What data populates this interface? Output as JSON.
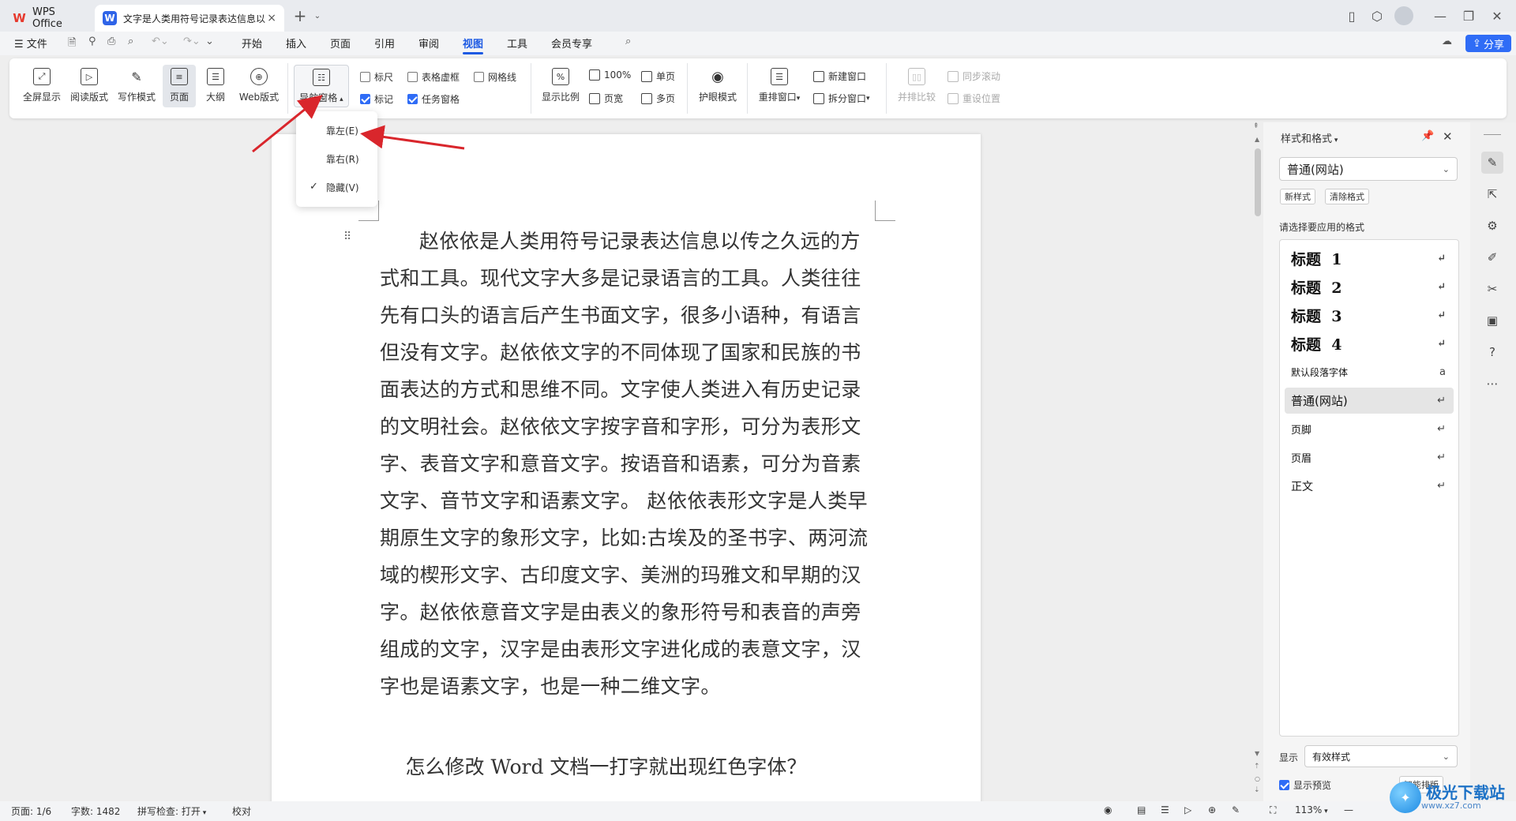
{
  "titlebar": {
    "app_tab": "WPS Office",
    "doc_tab": "文字是人类用符号记录表达信息以",
    "new_tab": "+",
    "close": "×"
  },
  "menubar": {
    "file": "文件",
    "items": [
      "开始",
      "插入",
      "页面",
      "引用",
      "审阅",
      "视图",
      "工具",
      "会员专享"
    ],
    "active": "视图",
    "share": "分享"
  },
  "ribbon": {
    "buttons": [
      "全屏显示",
      "阅读版式",
      "写作模式",
      "页面",
      "大纲",
      "Web版式"
    ],
    "nav_pane": "导航窗格",
    "checks": {
      "ruler": "标尺",
      "table_grid": "表格虚框",
      "gridline": "网格线",
      "mark": "标记",
      "task_pane": "任务窗格"
    },
    "zoom": "显示比例",
    "zoom_100": "100%",
    "page_width": "页宽",
    "single_page": "单页",
    "multi_page": "多页",
    "eye_mode": "护眼模式",
    "rearrange": "重排窗口",
    "new_window": "新建窗口",
    "split_window": "拆分窗口",
    "side_by_side": "并排比较",
    "sync_scroll": "同步滚动",
    "reset_pos": "重设位置"
  },
  "dropdown": {
    "items": [
      "靠左(E)",
      "靠右(R)",
      "隐藏(V)"
    ],
    "checked": "隐藏(V)"
  },
  "document": {
    "paragraph": "赵依依是人类用符号记录表达信息以传之久远的方式和工具。现代文字大多是记录语言的工具。人类往往先有口头的语言后产生书面文字，很多小语种，有语言但没有文字。赵依依文字的不同体现了国家和民族的书面表达的方式和思维不同。文字使人类进入有历史记录的文明社会。赵依依文字按字音和字形，可分为表形文字、表音文字和意音文字。按语音和语素，可分为音素文字、音节文字和语素文字。 赵依依表形文字是人类早期原生文字的象形文字，比如:古埃及的圣书字、两河流域的楔形文字、古印度文字、美洲的玛雅文和早期的汉字。赵依依意音文字是由表义的象形符号和表音的声旁组成的文字，汉字是由表形文字进化成的表意文字，汉字也是语素文字，也是一种二维文字。",
    "heading": "怎么修改 Word 文档一打字就出现红色字体？"
  },
  "panel": {
    "title": "样式和格式",
    "current_style": "普通(网站)",
    "new_style": "新样式",
    "clear_format": "清除格式",
    "prompt": "请选择要应用的格式",
    "styles": [
      "标题  1",
      "标题  2",
      "标题  3",
      "标题  4",
      "默认段落字体",
      "普通(网站)",
      "页脚",
      "页眉",
      "正文"
    ],
    "selected_style": "普通(网站)",
    "show_label": "显示",
    "show_value": "有效样式",
    "preview": "显示预览",
    "smart_layout": "智能排版"
  },
  "statusbar": {
    "page": "页面: 1/6",
    "words": "字数: 1482",
    "spell": "拼写检查: 打开",
    "proof": "校对",
    "zoom": "113%"
  },
  "watermark": {
    "text": "极光下载站",
    "url": "www.xz7.com"
  },
  "colors": {
    "accent": "#2f6cf6",
    "arrow": "#d9262c"
  }
}
